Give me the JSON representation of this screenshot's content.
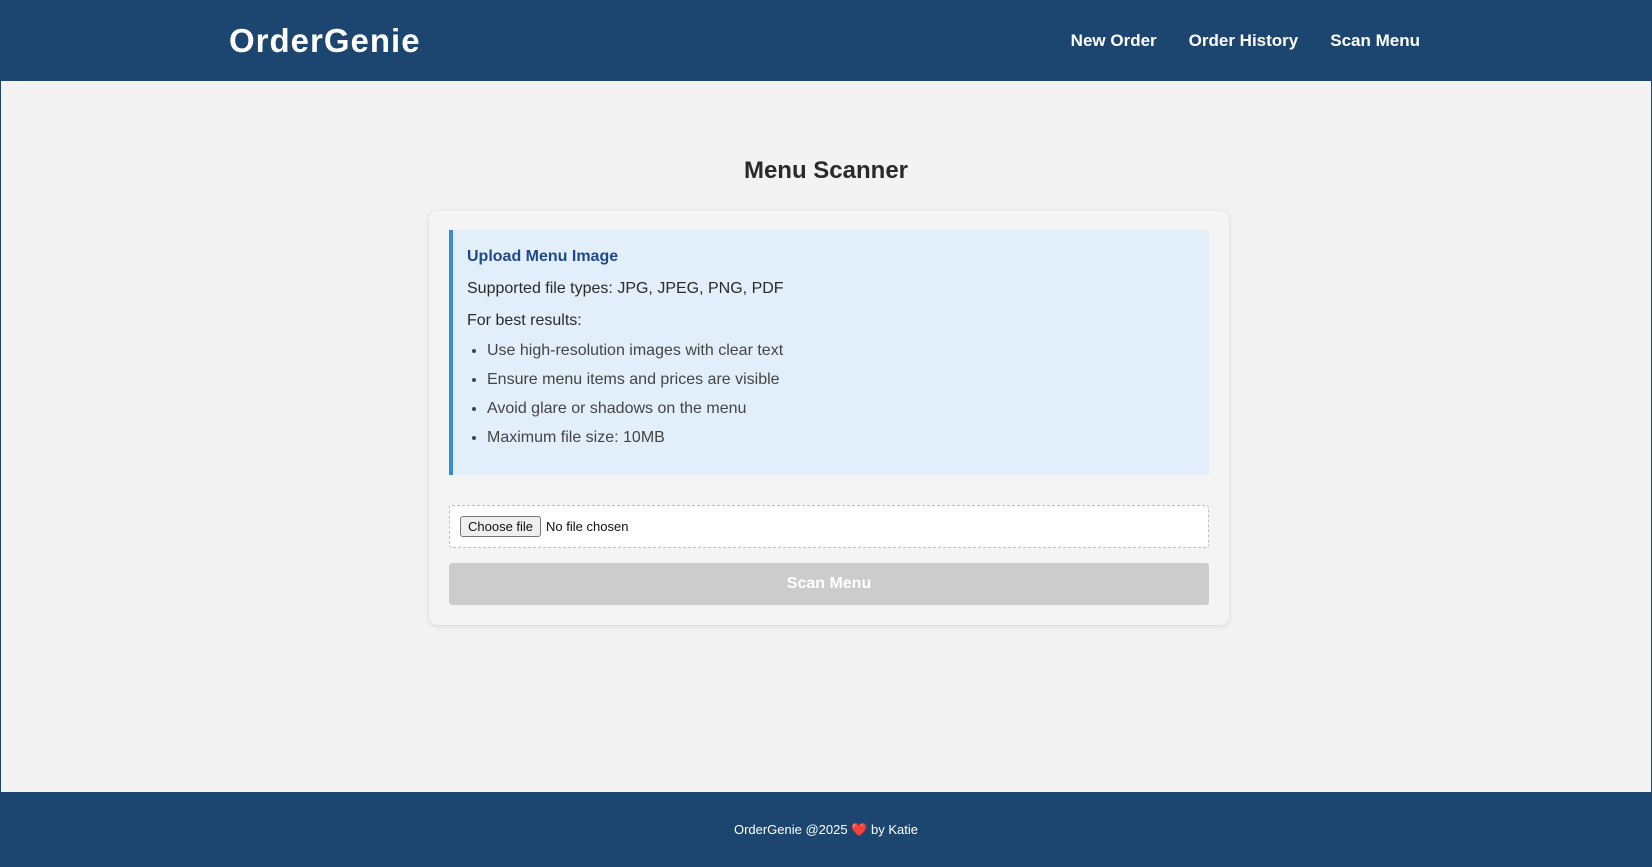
{
  "header": {
    "logo": "OrderGenie",
    "nav": [
      "New Order",
      "Order History",
      "Scan Menu"
    ]
  },
  "main": {
    "title": "Menu Scanner",
    "info": {
      "title": "Upload Menu Image",
      "supported": "Supported file types: JPG, JPEG, PNG, PDF",
      "best_results": "For best results:",
      "tips": [
        "Use high-resolution images with clear text",
        "Ensure menu items and prices are visible",
        "Avoid glare or shadows on the menu",
        "Maximum file size: 10MB"
      ]
    },
    "file_input": {
      "button": "Choose file",
      "status": "No file chosen"
    },
    "scan_button": "Scan Menu"
  },
  "footer": {
    "text_before": "OrderGenie @2025",
    "heart": "❤️",
    "text_after": "by Katie"
  },
  "colors": {
    "header_bg": "#1c4670",
    "page_bg": "#f3f3f3",
    "info_bg": "#e2effa",
    "info_accent": "#3a8ad6",
    "info_title": "#1f4a8a",
    "disabled_button": "#cccccc"
  }
}
